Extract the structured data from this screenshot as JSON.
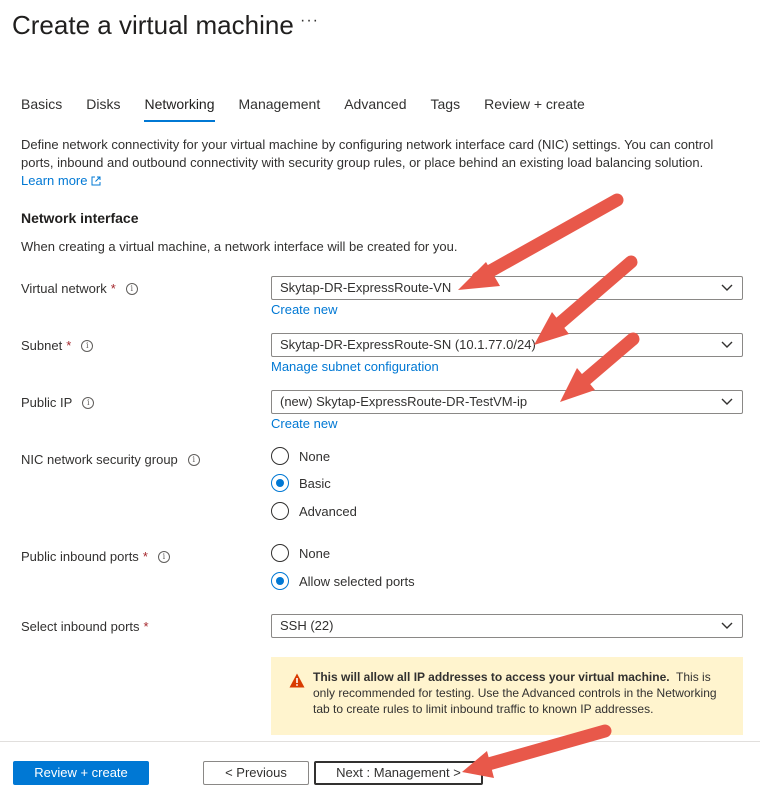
{
  "header": {
    "title": "Create a virtual machine",
    "more": "···"
  },
  "tabs": [
    {
      "label": "Basics"
    },
    {
      "label": "Disks"
    },
    {
      "label": "Networking"
    },
    {
      "label": "Management"
    },
    {
      "label": "Advanced"
    },
    {
      "label": "Tags"
    },
    {
      "label": "Review + create"
    }
  ],
  "intro": {
    "text": "Define network connectivity for your virtual machine by configuring network interface card (NIC) settings. You can control ports, inbound and outbound connectivity with security group rules, or place behind an existing load balancing solution.",
    "learn_more": "Learn more"
  },
  "network_interface": {
    "heading": "Network interface",
    "description": "When creating a virtual machine, a network interface will be created for you."
  },
  "fields": {
    "virtual_network": {
      "label": "Virtual network",
      "value": "Skytap-DR-ExpressRoute-VN",
      "link": "Create new"
    },
    "subnet": {
      "label": "Subnet",
      "value": "Skytap-DR-ExpressRoute-SN (10.1.77.0/24)",
      "link": "Manage subnet configuration"
    },
    "public_ip": {
      "label": "Public IP",
      "value": "(new) Skytap-ExpressRoute-DR-TestVM-ip",
      "link": "Create new"
    },
    "nic_nsg": {
      "label": "NIC network security group",
      "options": [
        "None",
        "Basic",
        "Advanced"
      ],
      "selected": "Basic"
    },
    "public_inbound": {
      "label": "Public inbound ports",
      "options": [
        "None",
        "Allow selected ports"
      ],
      "selected": "Allow selected ports"
    },
    "inbound_ports": {
      "label": "Select inbound ports",
      "value": "SSH (22)"
    }
  },
  "required_marker": "*",
  "info_glyph": "i",
  "warning": {
    "bold": "This will allow all IP addresses to access your virtual machine.",
    "text": "This is only recommended for testing.  Use the Advanced controls in the Networking tab to create rules to limit inbound traffic to known IP addresses."
  },
  "footer": {
    "review_create": "Review + create",
    "previous": "< Previous",
    "next": "Next : Management >"
  },
  "colors": {
    "accent": "#0078d4",
    "required": "#a4262c",
    "warning_bg": "#fff4ce",
    "warning_icon": "#d83b01",
    "annotation_arrow": "#e8584a"
  }
}
